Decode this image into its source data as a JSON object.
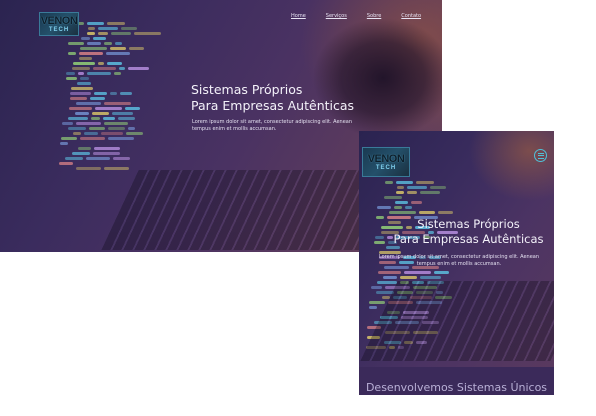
{
  "desktop": {
    "logo": {
      "line1": "VENON",
      "line2": "TECH"
    },
    "nav": [
      "Home",
      "Serviços",
      "Sobre",
      "Contato"
    ],
    "hero": {
      "title_line1": "Sistemas Próprios",
      "title_line2": "Para Empresas Autênticas",
      "text": "Lorem ipsum dolor sit amet, consectetur adipiscing elit. Aenean tempus enim et mollis accumsan."
    }
  },
  "mobile": {
    "logo": {
      "line1": "VENON",
      "line2": "TECH"
    },
    "menu_icon": "hamburger-icon",
    "hero": {
      "title_line1": "Sistemas Próprios",
      "title_line2": "Para Empresas Autênticas",
      "text": "Lorem ipsum dolor sit amet, consectetur adipiscing elit. Aenean tempus enim et mollis accumsan."
    },
    "section_title": "Desenvolvemos Sistemas Únicos"
  },
  "colors": {
    "accent": "#4fc0d8",
    "overlay": "#3b2a5a"
  }
}
